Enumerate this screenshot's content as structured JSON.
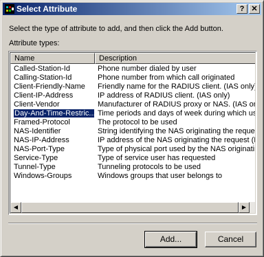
{
  "window": {
    "title": "Select Attribute",
    "help_glyph": "?",
    "close_glyph": "✕"
  },
  "instructions": "Select the type of attribute to add, and then click the Add button.",
  "list_label": "Attribute types:",
  "columns": [
    "Name",
    "Description"
  ],
  "rows": [
    {
      "name": "Called-Station-Id",
      "description": "Phone number dialed by user"
    },
    {
      "name": "Calling-Station-Id",
      "description": "Phone number from which call originated"
    },
    {
      "name": "Client-Friendly-Name",
      "description": "Friendly name for the RADIUS client. (IAS only)"
    },
    {
      "name": "Client-IP-Address",
      "description": "IP address of RADIUS client. (IAS only)"
    },
    {
      "name": "Client-Vendor",
      "description": "Manufacturer of RADIUS proxy or NAS. (IAS onl"
    },
    {
      "name": "Day-And-Time-Restric...",
      "description": "Time periods and days of week during which use"
    },
    {
      "name": "Framed-Protocol",
      "description": "The protocol to be used"
    },
    {
      "name": "NAS-Identifier",
      "description": "String identifying the NAS originating the request"
    },
    {
      "name": "NAS-IP-Address",
      "description": "IP address of the NAS originating the request (IA"
    },
    {
      "name": "NAS-Port-Type",
      "description": "Type of physical port used by the NAS originatin"
    },
    {
      "name": "Service-Type",
      "description": "Type of service user has requested"
    },
    {
      "name": "Tunnel-Type",
      "description": "Tunneling protocols to be used"
    },
    {
      "name": "Windows-Groups",
      "description": "Windows groups that user belongs to"
    }
  ],
  "selected_row": "Day-And-Time-Restric...",
  "buttons": {
    "add": "Add...",
    "cancel": "Cancel"
  },
  "scroll_arrows": {
    "left": "◀",
    "right": "▶"
  },
  "colors": {
    "title_start": "#0a246a",
    "title_end": "#a6caf0",
    "selection": "#0a246a",
    "face": "#d4d0c8"
  }
}
